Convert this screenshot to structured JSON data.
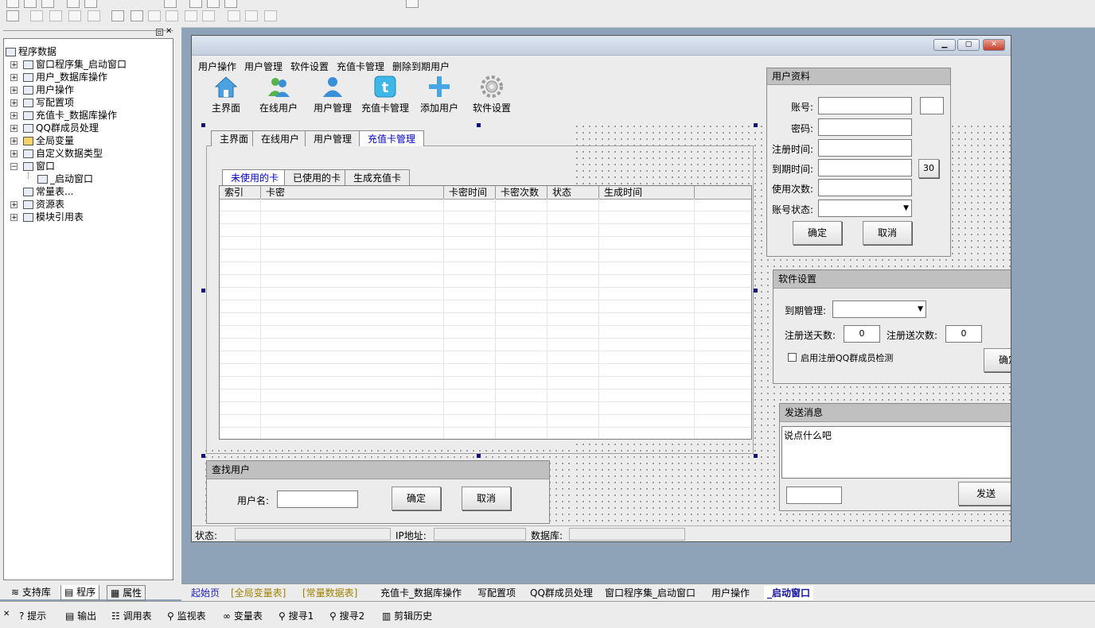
{
  "left_panel": {
    "tree_root": "程序数据",
    "tree_items": [
      "窗口程序集_启动窗口",
      "用户_数据库操作",
      "用户操作",
      "写配置项",
      "充值卡_数据库操作",
      "QQ群成员处理",
      "全局变量",
      "自定义数据类型",
      "窗口",
      "_启动窗口",
      "常量表...",
      "资源表",
      "模块引用表"
    ],
    "tabs": [
      "支持库",
      "程序",
      "属性"
    ]
  },
  "form": {
    "menu": [
      "用户操作",
      "用户管理",
      "软件设置",
      "充值卡管理",
      "删除到期用户"
    ],
    "toolbar": [
      "主界面",
      "在线用户",
      "用户管理",
      "充值卡管理",
      "添加用户",
      "软件设置"
    ],
    "main_tabs": [
      "主界面",
      "在线用户",
      "用户管理",
      "充值卡管理"
    ],
    "sub_tabs": [
      "未使用的卡",
      "已使用的卡",
      "生成充值卡"
    ],
    "columns": [
      "索引",
      "卡密",
      "卡密时间",
      "卡密次数",
      "状态",
      "生成时间"
    ],
    "user_info": {
      "title": "用户资料",
      "account_label": "账号:",
      "password_label": "密码:",
      "register_label": "注册时间:",
      "expire_label": "到期时间:",
      "usage_label": "使用次数:",
      "status_label": "账号状态:",
      "days_button": "30",
      "ok": "确定",
      "cancel": "取消"
    },
    "software": {
      "title": "软件设置",
      "expire_manage_label": "到期管理:",
      "reg_days_label": "注册送天数:",
      "reg_days_value": "0",
      "reg_times_label": "注册送次数:",
      "reg_times_value": "0",
      "qq_check_label": "启用注册QQ群成员检测",
      "ok_partial": "确定"
    },
    "message": {
      "title": "发送消息",
      "text": "说点什么吧",
      "send": "发送"
    },
    "find_user": {
      "title": "查找用户",
      "username_label": "用户名:",
      "ok": "确定",
      "cancel": "取消"
    },
    "status": {
      "status_label": "状态:",
      "ip_label": "IP地址:",
      "db_label": "数据库:"
    }
  },
  "doc_tabs": [
    "起始页",
    "[全局变量表]",
    "[常量数据表]",
    "充值卡_数据库操作",
    "写配置项",
    "QQ群成员处理",
    "窗口程序集_启动窗口",
    "用户操作",
    "_启动窗口"
  ],
  "bottom_tabs": [
    "提示",
    "输出",
    "调用表",
    "监视表",
    "变量表",
    "搜寻1",
    "搜寻2",
    "剪辑历史"
  ],
  "colors": {
    "active_tab_text": "#0000c8",
    "designer_bg": "#8fa3b8",
    "start_tab_text": "#2020c0",
    "bracket_tab_text": "#a08000"
  }
}
